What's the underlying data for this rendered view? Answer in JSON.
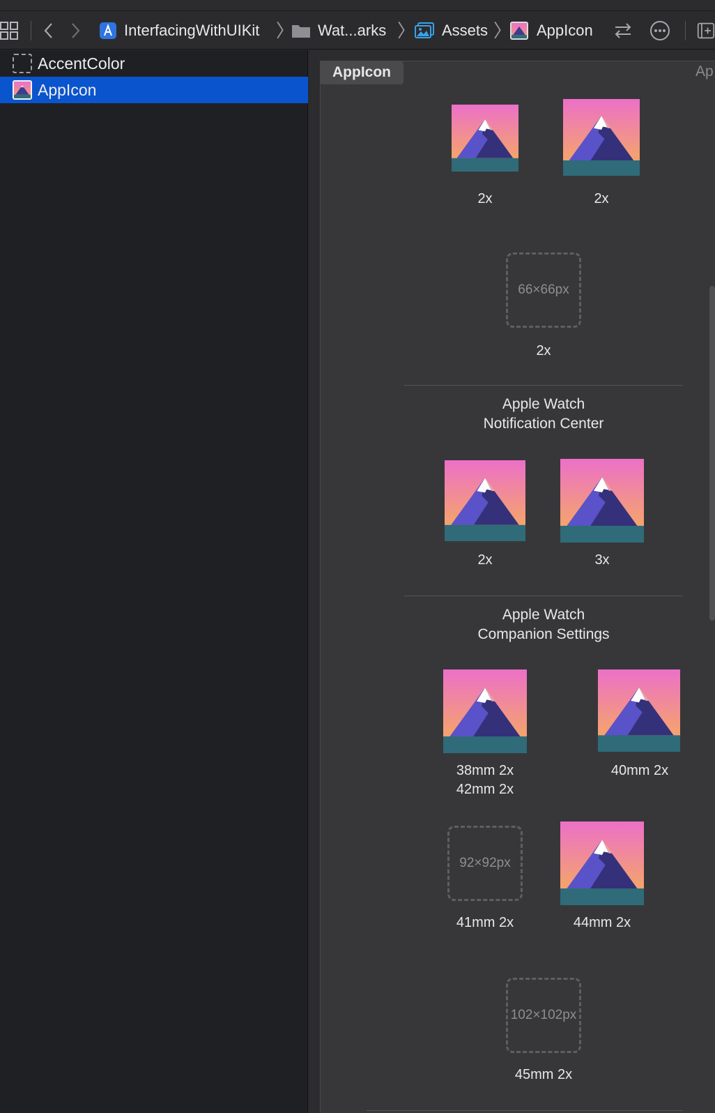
{
  "navbar": {
    "breadcrumbs": [
      {
        "label": "InterfacingWithUIKit",
        "icon": "xcode-project-icon"
      },
      {
        "label": "Wat...arks",
        "icon": "folder-icon"
      },
      {
        "label": "Assets",
        "icon": "asset-catalog-icon"
      },
      {
        "label": "AppIcon",
        "icon": "app-icon-thumbnail"
      }
    ]
  },
  "sidebar": {
    "items": [
      {
        "label": "AccentColor",
        "icon": "color-set-icon",
        "selected": false
      },
      {
        "label": "AppIcon",
        "icon": "app-icon-thumbnail",
        "selected": true
      }
    ],
    "accent_color": "#0a55ce"
  },
  "editor": {
    "tab_label": "AppIcon",
    "right_label": "Ap",
    "slots_top": [
      {
        "label": "2x",
        "filled": true
      },
      {
        "label": "2x",
        "filled": true
      },
      {
        "label": "2x",
        "filled": false,
        "placeholder": "66×66px"
      }
    ],
    "sections": [
      {
        "title_line1": "Apple Watch",
        "title_line2": "Notification Center",
        "slots": [
          {
            "label": "2x",
            "filled": true
          },
          {
            "label": "3x",
            "filled": true
          }
        ]
      },
      {
        "title_line1": "Apple Watch",
        "title_line2": "Companion Settings",
        "slots": [
          {
            "label_line1": "38mm 2x",
            "label_line2": "42mm 2x",
            "filled": true
          },
          {
            "label": "40mm 2x",
            "filled": true
          },
          {
            "label": "41mm 2x",
            "filled": false,
            "placeholder": "92×92px"
          },
          {
            "label": "44mm 2x",
            "filled": true
          },
          {
            "label": "45mm 2x",
            "filled": false,
            "placeholder": "102×102px"
          }
        ]
      }
    ]
  }
}
